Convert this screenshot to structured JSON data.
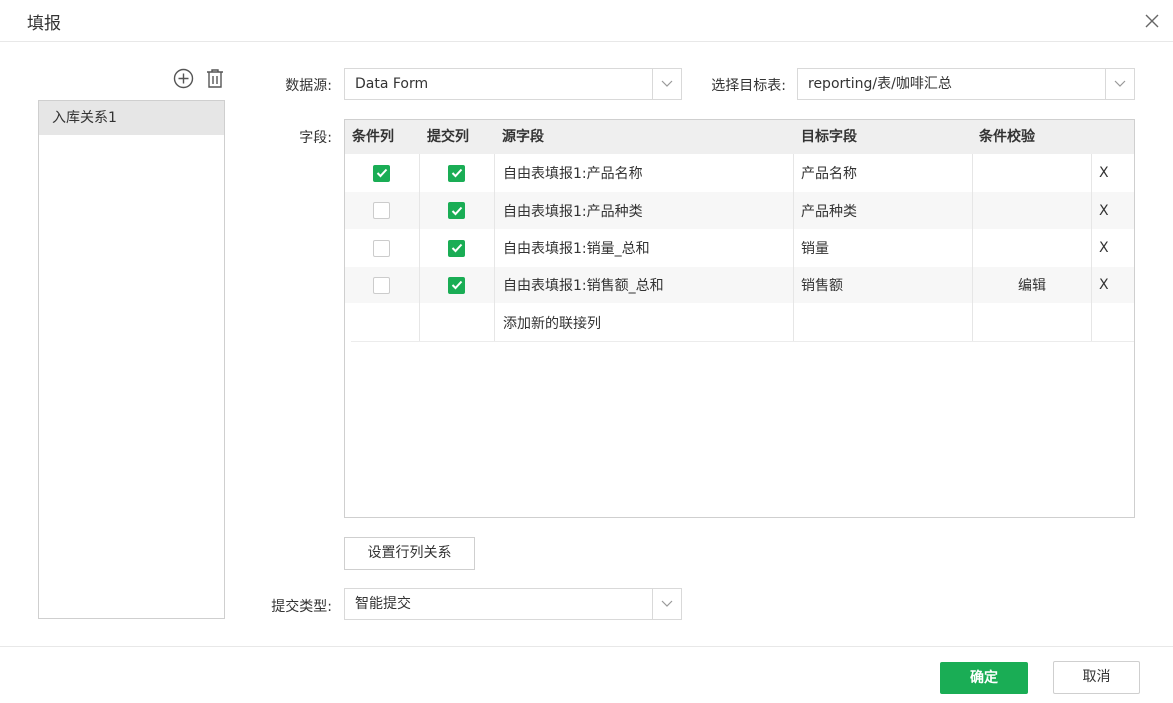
{
  "dialog": {
    "title": "填报"
  },
  "sidebar": {
    "items": [
      {
        "label": "入库关系1",
        "selected": true
      }
    ]
  },
  "form": {
    "datasource_label": "数据源:",
    "datasource_value": "Data Form",
    "target_label": "选择目标表:",
    "target_value": "reporting/表/咖啡汇总",
    "fields_label": "字段:",
    "submit_type_label": "提交类型:",
    "submit_type_value": "智能提交"
  },
  "table": {
    "headers": [
      "条件列",
      "提交列",
      "源字段",
      "目标字段",
      "条件校验"
    ],
    "rows": [
      {
        "condition": true,
        "submit": true,
        "source": "自由表填报1:产品名称",
        "target": "产品名称",
        "check": "",
        "delete": "X"
      },
      {
        "condition": false,
        "submit": true,
        "source": "自由表填报1:产品种类",
        "target": "产品种类",
        "check": "",
        "delete": "X"
      },
      {
        "condition": false,
        "submit": true,
        "source": "自由表填报1:销量_总和",
        "target": "销量",
        "check": "",
        "delete": "X"
      },
      {
        "condition": false,
        "submit": true,
        "source": "自由表填报1:销售额_总和",
        "target": "销售额",
        "check": "编辑",
        "delete": "X"
      }
    ],
    "add_row_label": "添加新的联接列"
  },
  "buttons": {
    "config": "设置行列关系",
    "ok": "确定",
    "cancel": "取消"
  },
  "icons": {
    "close": "close-icon",
    "add": "add-circle-icon",
    "delete": "trash-icon",
    "dropdown": "chevron-down-icon",
    "check": "check-icon"
  },
  "colors": {
    "accent": "#1aad55",
    "selected_item_bg": "#e6e6e6",
    "header_bg": "#efefef"
  }
}
